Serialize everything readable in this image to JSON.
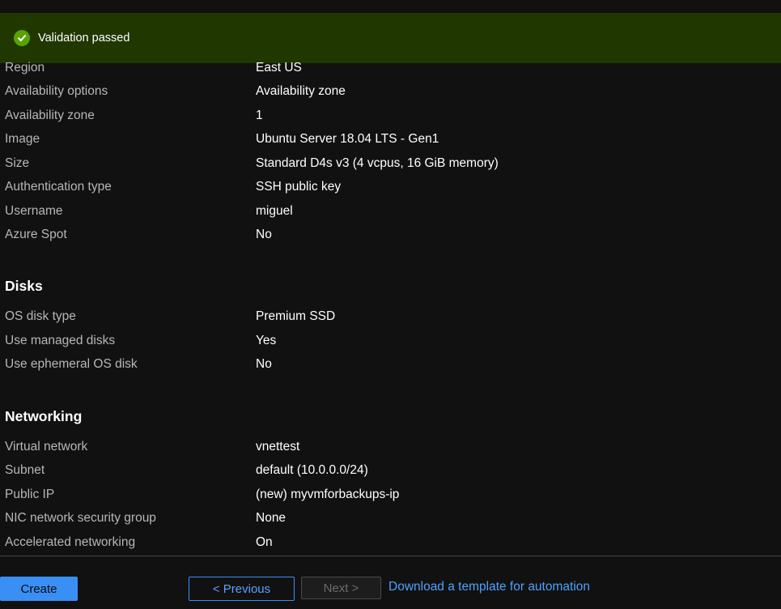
{
  "banner": {
    "text": "Validation passed",
    "icon": "checkmark-circle-icon",
    "color": "#57a300"
  },
  "basics_rows": [
    {
      "label": "Region",
      "value": "East US"
    },
    {
      "label": "Availability options",
      "value": "Availability zone"
    },
    {
      "label": "Availability zone",
      "value": "1"
    },
    {
      "label": "Image",
      "value": "Ubuntu Server 18.04 LTS - Gen1"
    },
    {
      "label": "Size",
      "value": "Standard D4s v3 (4 vcpus, 16 GiB memory)"
    },
    {
      "label": "Authentication type",
      "value": "SSH public key"
    },
    {
      "label": "Username",
      "value": "miguel"
    },
    {
      "label": "Azure Spot",
      "value": "No"
    }
  ],
  "disks": {
    "heading": "Disks",
    "rows": [
      {
        "label": "OS disk type",
        "value": "Premium SSD"
      },
      {
        "label": "Use managed disks",
        "value": "Yes"
      },
      {
        "label": "Use ephemeral OS disk",
        "value": "No"
      }
    ]
  },
  "networking": {
    "heading": "Networking",
    "rows": [
      {
        "label": "Virtual network",
        "value": "vnettest"
      },
      {
        "label": "Subnet",
        "value": "default (10.0.0.0/24)"
      },
      {
        "label": "Public IP",
        "value": "(new) myvmforbackups-ip"
      },
      {
        "label": "NIC network security group",
        "value": "None"
      },
      {
        "label": "Accelerated networking",
        "value": "On"
      }
    ]
  },
  "footer": {
    "create_label": "Create",
    "previous_label": "< Previous",
    "next_label": "Next >",
    "download_label": "Download a template for automation"
  }
}
